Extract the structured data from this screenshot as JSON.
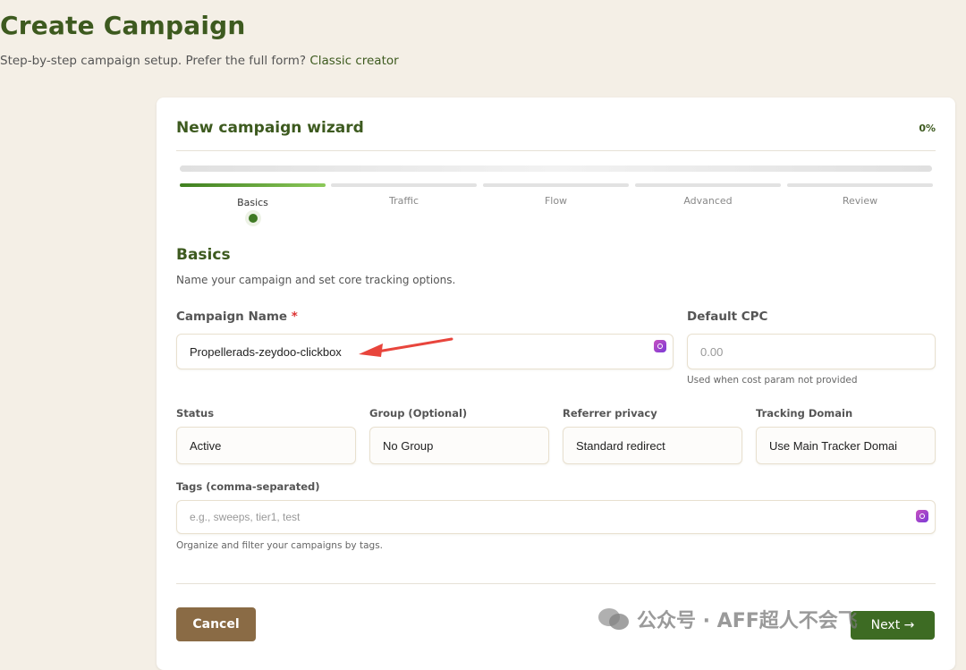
{
  "page": {
    "title": "Create Campaign",
    "subtitle_text": "Step-by-step campaign setup. Prefer the full form?",
    "subtitle_link": "Classic creator"
  },
  "wizard": {
    "title": "New campaign wizard",
    "progress_percent_label": "0%",
    "progress_fill": 1.0,
    "steps": [
      {
        "label": "Basics",
        "active": true
      },
      {
        "label": "Traffic",
        "active": false
      },
      {
        "label": "Flow",
        "active": false
      },
      {
        "label": "Advanced",
        "active": false
      },
      {
        "label": "Review",
        "active": false
      }
    ]
  },
  "basics": {
    "section_title": "Basics",
    "section_desc": "Name your campaign and set core tracking options.",
    "campaign_name_label": "Campaign Name",
    "required_mark": "*",
    "campaign_name_value": "Propellerads-zeydoo-clickbox",
    "default_cpc_label": "Default CPC",
    "default_cpc_placeholder": "0.00",
    "default_cpc_help": "Used when cost param not provided",
    "status_label": "Status",
    "status_value": "Active",
    "group_label": "Group (Optional)",
    "group_value": "No Group",
    "referrer_label": "Referrer privacy",
    "referrer_value": "Standard redirect",
    "tracking_domain_label": "Tracking Domain",
    "tracking_domain_value": "Use Main Tracker Domai",
    "tags_label": "Tags (comma-separated)",
    "tags_placeholder": "e.g., sweeps, tier1, test",
    "tags_help": "Organize and filter your campaigns by tags."
  },
  "actions": {
    "cancel_label": "Cancel",
    "next_label": "Next →"
  },
  "watermark": {
    "text": "公众号 · AFF超人不会飞"
  },
  "colors": {
    "brand_green": "#3d5a1f",
    "progress_green": "#4c8a2b",
    "cancel_brown": "#8a6b45",
    "next_green": "#3d6b23",
    "page_bg": "#f4efe6",
    "annotation_red": "#e8453c"
  },
  "icons": {
    "field_badge": "password-manager-icon",
    "step_marker": "current-step-dot-icon",
    "annotation": "red-arrow-icon",
    "watermark_logo": "wechat-icon"
  }
}
